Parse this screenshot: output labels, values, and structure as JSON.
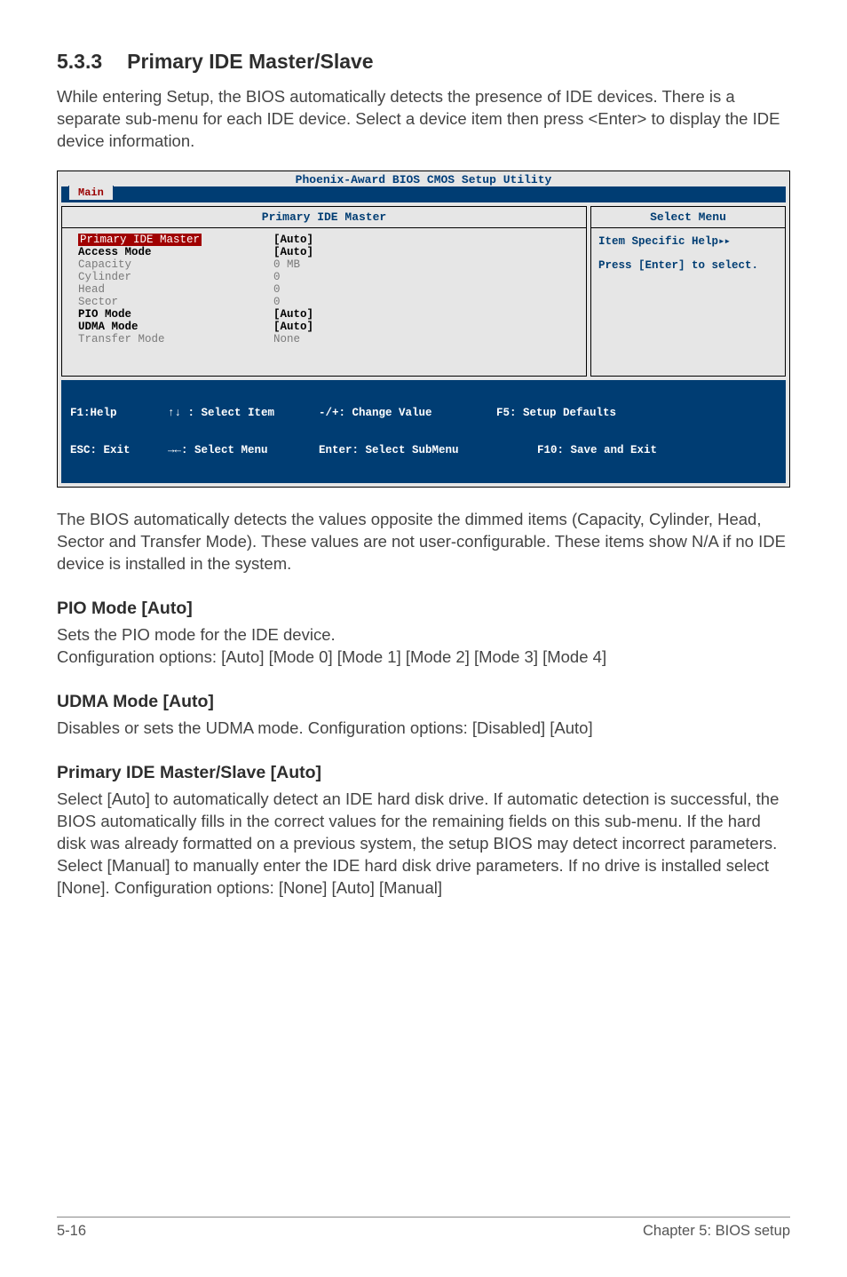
{
  "section": {
    "number": "5.3.3",
    "title": "Primary IDE Master/Slave"
  },
  "intro": "While entering Setup, the BIOS automatically detects the presence of IDE devices. There is a separate sub-menu for each IDE device. Select a device item then press <Enter> to display the IDE device information.",
  "bios": {
    "titlebar": "Phoenix-Award BIOS CMOS Setup Utility",
    "tab": "Main",
    "left_head": "Primary IDE Master",
    "right_head": "Select Menu",
    "rows": [
      {
        "label": "Primary IDE Master",
        "value": "[Auto]",
        "style": "hl",
        "val_style": "strong"
      },
      {
        "label": "Access Mode",
        "value": "[Auto]",
        "style": "strong",
        "val_style": "strong"
      },
      {
        "label": " ",
        "value": " "
      },
      {
        "label": "Capacity",
        "value": "0 MB",
        "style": "dim",
        "val_style": "dim"
      },
      {
        "label": " ",
        "value": " "
      },
      {
        "label": "Cylinder",
        "value": "0",
        "style": "dim",
        "val_style": "dim"
      },
      {
        "label": "Head",
        "value": "0",
        "style": "dim",
        "val_style": "dim"
      },
      {
        "label": "Sector",
        "value": "0",
        "style": "dim",
        "val_style": "dim"
      },
      {
        "label": "PIO Mode",
        "value": "[Auto]",
        "style": "strong",
        "val_style": "strong"
      },
      {
        "label": "UDMA Mode",
        "value": "[Auto]",
        "style": "strong",
        "val_style": "strong"
      },
      {
        "label": "Transfer Mode",
        "value": "None",
        "style": "dim",
        "val_style": "dim"
      }
    ],
    "help_line1": "Item Specific Help",
    "help_arrows": "▸▸",
    "help_line2": "Press [Enter] to select.",
    "footer": {
      "f1": "F1:Help",
      "esc": "ESC: Exit",
      "sel_item": "↑↓ : Select Item",
      "sel_menu": "→←: Select Menu",
      "change_val": "-/+: Change Value",
      "enter_sub": "Enter: Select SubMenu",
      "f5": "F5: Setup Defaults",
      "f10": "F10: Save and Exit"
    }
  },
  "after_bios": "The BIOS automatically detects the values opposite the dimmed items (Capacity, Cylinder,  Head, Sector and Transfer Mode). These values are not user-configurable. These items show N/A if no IDE device is installed in the system.",
  "pio": {
    "head": "PIO Mode [Auto]",
    "l1": "Sets the PIO mode for the IDE device.",
    "l2": "Configuration options: [Auto] [Mode 0] [Mode 1] [Mode 2] [Mode 3] [Mode 4]"
  },
  "udma": {
    "head": "UDMA Mode [Auto]",
    "l1": "Disables or sets the UDMA mode. Configuration options: [Disabled] [Auto]"
  },
  "primary": {
    "head": "Primary IDE Master/Slave [Auto]",
    "body": "Select [Auto] to automatically detect an IDE hard disk drive. If automatic detection is successful, the BIOS automatically fills in the correct values for the remaining fields on this sub-menu. If the hard disk was already formatted on a previous system, the setup BIOS may detect incorrect parameters. Select [Manual] to manually enter the IDE hard disk drive parameters. If no drive is installed select [None]. Configuration options: [None] [Auto] [Manual]"
  },
  "footer": {
    "left": "5-16",
    "right": "Chapter 5: BIOS setup"
  }
}
